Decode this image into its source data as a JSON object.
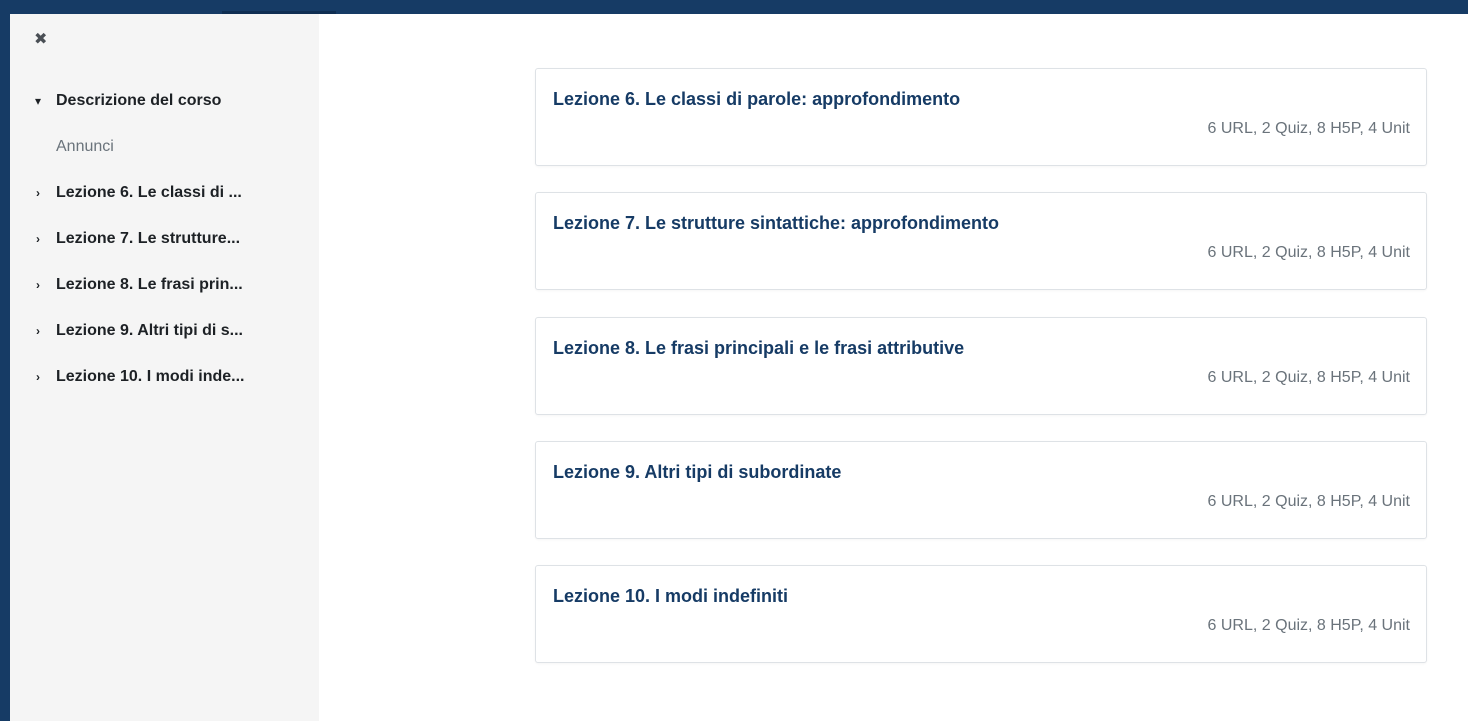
{
  "drawer": {
    "close_icon": "close-icon",
    "course_description": "Descrizione del corso",
    "announcements": "Annunci",
    "items": [
      {
        "label": "Lezione 6. Le classi di ..."
      },
      {
        "label": "Lezione 7. Le strutture..."
      },
      {
        "label": "Lezione 8. Le frasi prin..."
      },
      {
        "label": "Lezione 9. Altri tipi di s..."
      },
      {
        "label": "Lezione 10. I modi inde..."
      }
    ]
  },
  "sections": [
    {
      "title": "Lezione 6. Le classi di parole: approfondimento",
      "summary": "6 URL, 2 Quiz, 8 H5P, 4 Unit"
    },
    {
      "title": "Lezione 7. Le strutture sintattiche: approfondimento",
      "summary": "6 URL, 2 Quiz, 8 H5P, 4 Unit"
    },
    {
      "title": "Lezione 8. Le frasi principali e le frasi attributive",
      "summary": "6 URL, 2 Quiz, 8 H5P, 4 Unit"
    },
    {
      "title": "Lezione 9. Altri tipi di subordinate",
      "summary": "6 URL, 2 Quiz, 8 H5P, 4 Unit"
    },
    {
      "title": "Lezione 10. I modi indefiniti",
      "summary": "6 URL, 2 Quiz, 8 H5P, 4 Unit"
    }
  ],
  "colors": {
    "frame": "#163b65",
    "drawer_bg": "#f5f5f5",
    "title": "#163b65",
    "muted": "#6a737b"
  }
}
